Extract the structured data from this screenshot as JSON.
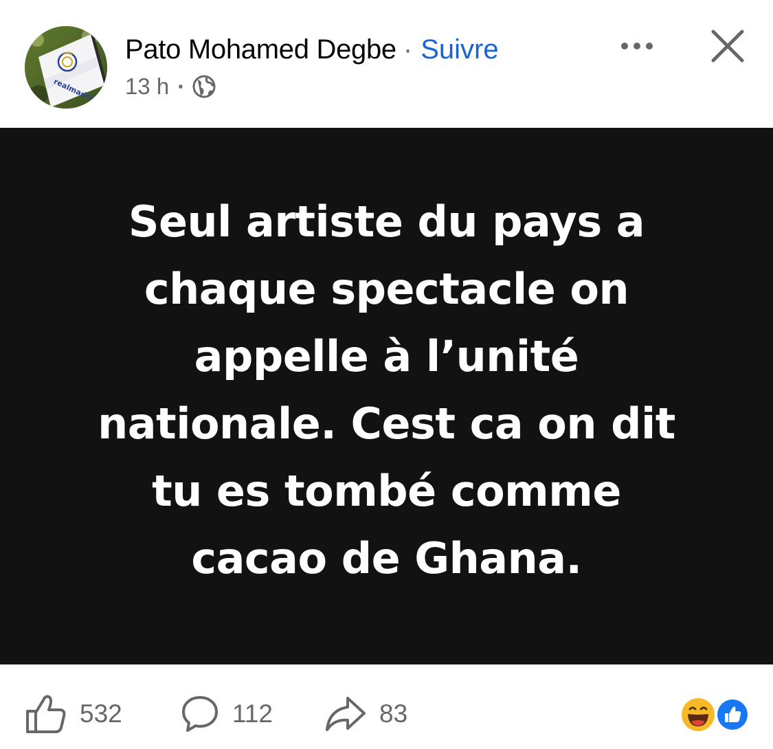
{
  "post": {
    "author_name": "Pato Mohamed Degbe",
    "separator": "·",
    "follow_label": "Suivre",
    "time": "13 h",
    "meta_separator": "·",
    "audience_icon": "globe-icon",
    "more_icon": "more-options-icon",
    "close_icon": "close-icon",
    "avatar_description_icon": "real-madrid-flag-avatar",
    "background_color": "#121212",
    "text_color": "#ffffff",
    "text_lines": [
      "Seul artiste du pays a",
      "chaque spectacle on",
      "appelle à l’unité",
      "nationale. Cest ca on dit",
      "tu es tombé comme",
      "cacao de Ghana."
    ]
  },
  "footer": {
    "like": {
      "icon": "thumbs-up-icon",
      "count": "532"
    },
    "comment": {
      "icon": "comment-bubble-icon",
      "count": "112"
    },
    "share": {
      "icon": "share-arrow-icon",
      "count": "83"
    },
    "reactions": [
      "laughing-face-icon",
      "like-reaction-icon"
    ]
  },
  "colors": {
    "accent": "#1b62d6",
    "secondary_text": "#65676b",
    "like_reaction": "#1877f2",
    "haha_reaction": "#f7b928"
  }
}
